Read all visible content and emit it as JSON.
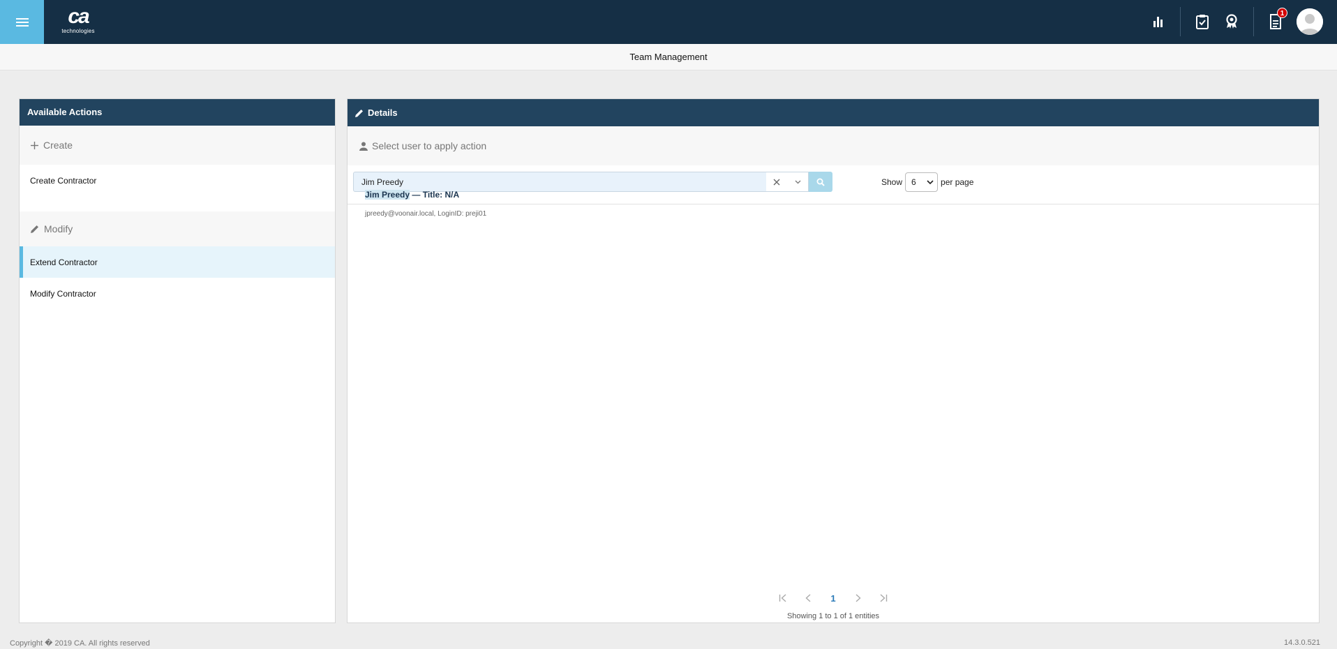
{
  "header": {
    "logo_text": "ca",
    "logo_subtext": "technologies",
    "notification_count": "1",
    "icons": [
      "menu-icon",
      "bar-chart-icon",
      "clipboard-check-icon",
      "award-icon",
      "document-icon",
      "user-avatar-icon"
    ]
  },
  "page_title": "Team Management",
  "actions_panel": {
    "title": "Available Actions",
    "sections": [
      {
        "label": "Create",
        "icon": "plus-icon",
        "items": [
          "Create Contractor"
        ]
      },
      {
        "label": "Modify",
        "icon": "pencil-icon",
        "items": [
          "Extend Contractor",
          "Modify Contractor"
        ]
      }
    ],
    "active_item": "Extend Contractor"
  },
  "details_panel": {
    "title": "Details",
    "select_prompt": "Select user to apply action",
    "search_value": "Jim Preedy",
    "show_label": "Show",
    "per_page_value": "6",
    "per_page_label": "per page",
    "results": [
      {
        "name": "Jim Preedy",
        "title_suffix": " — Title: N/A",
        "subtitle": "jpreedy@voonair.local, LoginID: preji01"
      }
    ],
    "pagination": {
      "current_page": "1",
      "info": "Showing 1 to 1 of 1 entities"
    }
  },
  "footer": {
    "copyright": "Copyright � 2019 CA. All rights reserved",
    "version": "14.3.0.521"
  },
  "colors": {
    "topbar": "#152f45",
    "accent": "#5ab9e1",
    "panel_header": "#22445f",
    "badge": "#d40000"
  }
}
